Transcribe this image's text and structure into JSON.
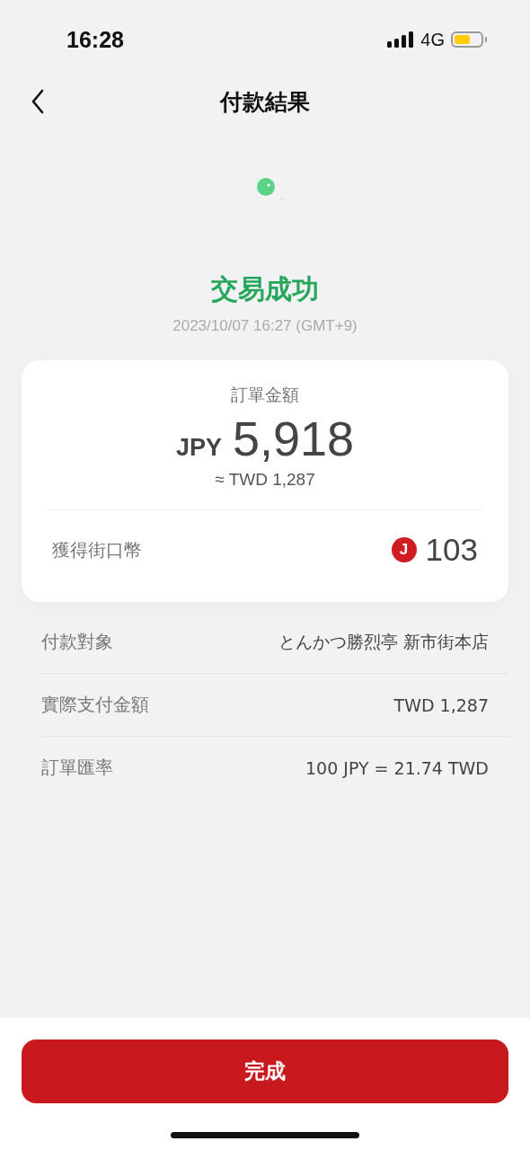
{
  "status_bar": {
    "time": "16:28",
    "network": "4G"
  },
  "header": {
    "title": "付款結果"
  },
  "result": {
    "title": "交易成功",
    "datetime": "2023/10/07 16:27 (GMT+9)"
  },
  "order_card": {
    "label": "訂單金額",
    "currency": "JPY",
    "amount": "5,918",
    "converted": "≈ TWD 1,287",
    "points_label": "獲得街口幣",
    "coin_symbol": "J",
    "points": "103"
  },
  "details": [
    {
      "label": "付款對象",
      "value": "とんかつ勝烈亭 新市街本店"
    },
    {
      "label": "實際支付金額",
      "value": "TWD 1,287"
    },
    {
      "label": "訂單匯率",
      "value": "100 JPY = 21.74 TWD"
    }
  ],
  "done_button": "完成"
}
